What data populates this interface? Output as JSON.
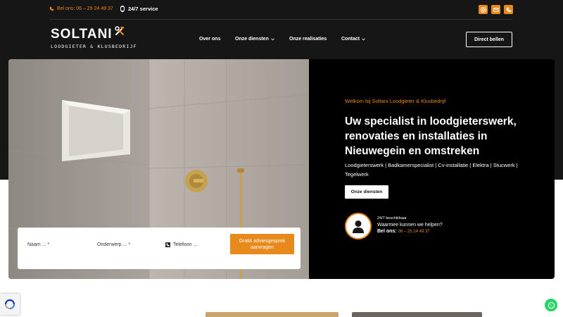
{
  "topbar": {
    "phone_label": "Bel ons: 06 – 25 24 49 37",
    "service_label": "24/7 service",
    "socials": [
      "instagram-icon",
      "mail-icon",
      "phone-icon"
    ]
  },
  "header": {
    "brand": "SOLTANI",
    "tagline": "LOODGIETER & KLUSBEDRIJF",
    "nav": [
      {
        "label": "Over ons"
      },
      {
        "label": "Onze diensten"
      },
      {
        "label": "Onze realisaties"
      },
      {
        "label": "Contact"
      }
    ],
    "cta_label": "Direct bellen"
  },
  "hero": {
    "welcome": "Welkom bij Soltani Loodgieter & Klusbedrijf",
    "title": "Uw specialist in loodgieterswerk, renovaties en installaties in Nieuwegein en omstreken",
    "services": "Loodgieterswerk | Badkamerspecialist | Cv-installatie | Elektra | Stucwerk | Tegelwerk",
    "button_label": "Onze diensten",
    "contact": {
      "availability": "24/7 beschikbaar",
      "question": "Waarmee kunnen we helpen?",
      "call_label": "Bel ons:",
      "call_number": "06 – 25 24 49 37"
    }
  },
  "form": {
    "name_placeholder": "Naam ... *",
    "subject_placeholder": "Onderwerp ... *",
    "phone_placeholder": "Telefoon ...",
    "submit_label": "Gratis adviesgesprek aanvragen"
  },
  "colors": {
    "accent": "#e8891c",
    "dark": "#161616",
    "panel": "#000000",
    "whatsapp": "#25d366"
  }
}
